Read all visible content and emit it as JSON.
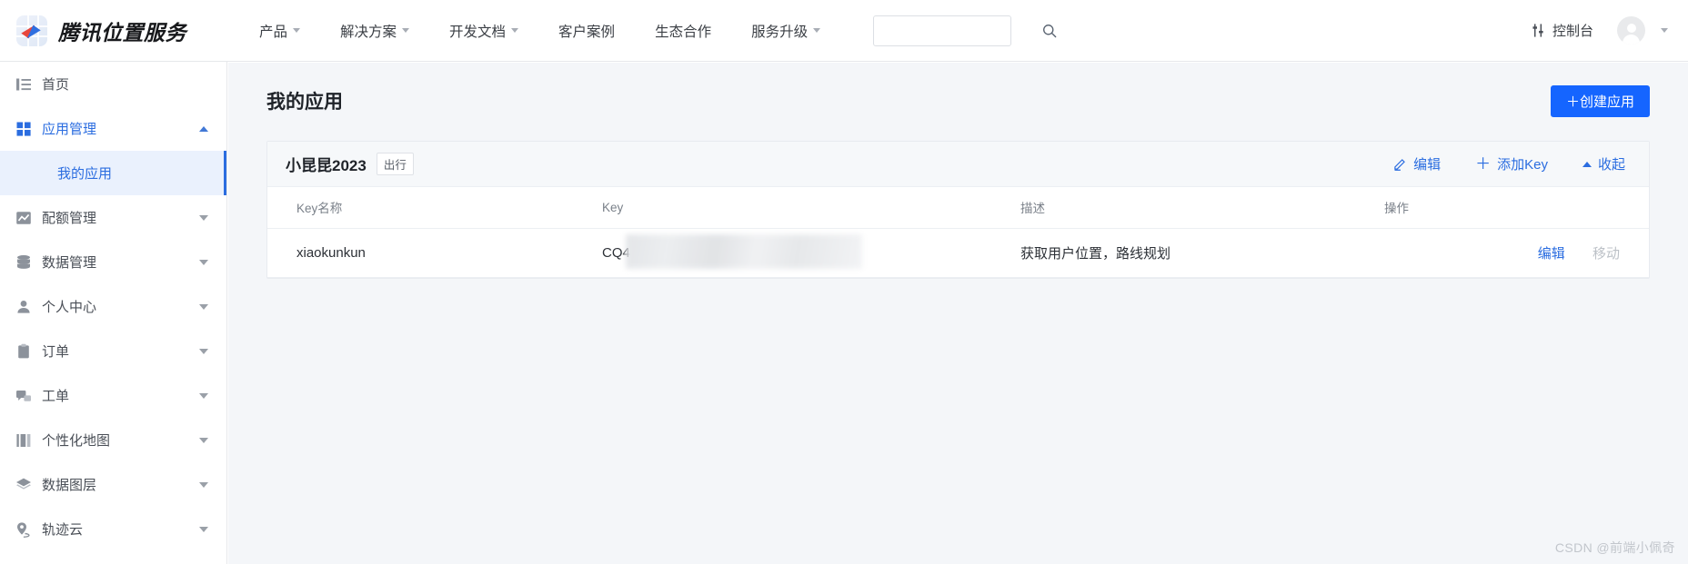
{
  "header": {
    "brand_name": "腾讯位置服务",
    "brand_logo_icon": "compass-logo-icon",
    "nav": [
      {
        "label": "产品",
        "has_caret": true
      },
      {
        "label": "解决方案",
        "has_caret": true
      },
      {
        "label": "开发文档",
        "has_caret": true
      },
      {
        "label": "客户案例",
        "has_caret": false
      },
      {
        "label": "生态合作",
        "has_caret": false
      },
      {
        "label": "服务升级",
        "has_caret": true
      }
    ],
    "search": {
      "value": "",
      "placeholder": "",
      "icon": "search-icon"
    },
    "console_label": "控制台",
    "console_icon": "sliders-icon",
    "avatar_icon": "user-avatar-icon",
    "avatar_caret_icon": "chevron-down-icon"
  },
  "sidebar": {
    "items": [
      {
        "label": "首页",
        "icon": "home-list-icon",
        "caret": "none",
        "active": false
      },
      {
        "label": "应用管理",
        "icon": "grid-squares-icon",
        "caret": "up",
        "active": true
      },
      {
        "label": "配额管理",
        "icon": "chart-wave-icon",
        "caret": "down",
        "active": false
      },
      {
        "label": "数据管理",
        "icon": "database-icon",
        "caret": "down",
        "active": false
      },
      {
        "label": "个人中心",
        "icon": "user-icon",
        "caret": "down",
        "active": false
      },
      {
        "label": "订单",
        "icon": "clipboard-icon",
        "caret": "down",
        "active": false
      },
      {
        "label": "工单",
        "icon": "chat-bubbles-icon",
        "caret": "down",
        "active": false
      },
      {
        "label": "个性化地图",
        "icon": "map-style-icon",
        "caret": "down",
        "active": false
      },
      {
        "label": "数据图层",
        "icon": "layers-icon",
        "caret": "down",
        "active": false
      },
      {
        "label": "轨迹云",
        "icon": "location-track-icon",
        "caret": "down",
        "active": false
      }
    ],
    "submenu": {
      "label": "我的应用",
      "parent_index": 1,
      "selected": true
    }
  },
  "main": {
    "page_title": "我的应用",
    "create_button": "＋创建应用",
    "app": {
      "name": "小昆昆2023",
      "tag": "出行",
      "actions": [
        {
          "label": "编辑",
          "icon": "pencil-icon"
        },
        {
          "label": "添加Key",
          "icon": "plus-icon"
        },
        {
          "label": "收起",
          "icon": "chevron-up-icon"
        }
      ]
    },
    "table": {
      "columns": [
        "Key名称",
        "Key",
        "描述",
        "操作"
      ],
      "rows": [
        {
          "key_name": "xiaokunkun",
          "key_value_visible": "CQ4",
          "key_value_redacted": true,
          "description": "获取用户位置，路线规划",
          "operations": [
            {
              "label": "编辑",
              "enabled": true
            },
            {
              "label": "移动",
              "enabled": false
            }
          ]
        }
      ]
    }
  },
  "watermark": "CSDN @前端小佩奇",
  "colors": {
    "brand_blue": "#2b6de0",
    "button_blue": "#1565ff",
    "page_bg": "#f4f6f9",
    "card_head_bg": "#f6f8fa",
    "active_sub_bg": "#eaf1fd",
    "text_primary": "#1f2329",
    "text_muted": "#7a8089",
    "disabled": "#bcc1c7"
  }
}
